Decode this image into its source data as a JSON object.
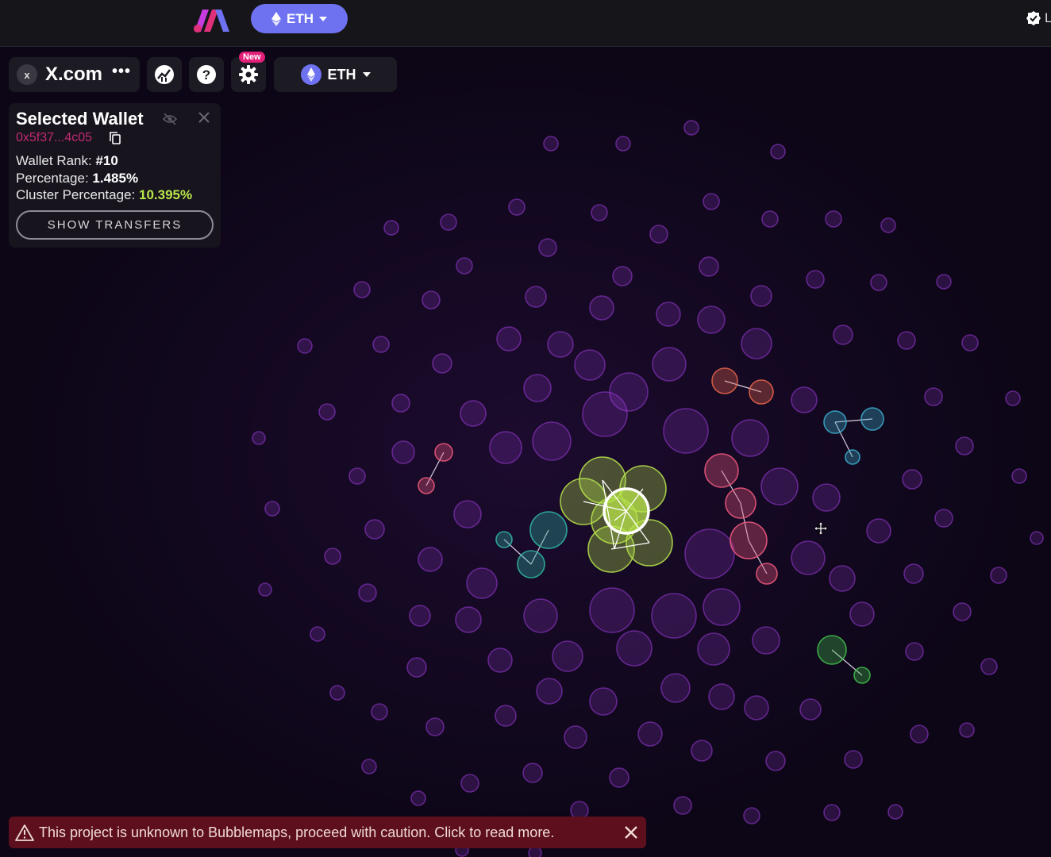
{
  "header": {
    "chain_label": "ETH",
    "user_initial": "L"
  },
  "toolbar": {
    "token_close": "x",
    "token_name": "X.com",
    "more_label": "•••",
    "new_badge": "New",
    "chain_label": "ETH"
  },
  "wallet_panel": {
    "title": "Selected Wallet",
    "address": "0x5f37...4c05",
    "rank_label": "Wallet Rank:",
    "rank_value": "#10",
    "percentage_label": "Percentage:",
    "percentage_value": "1.485%",
    "cluster_label": "Cluster Percentage:",
    "cluster_value": "10.395%",
    "show_transfers": "SHOW TRANSFERS"
  },
  "warning": {
    "text": "This project is unknown to Bubblemaps, proceed with caution. Click to read more."
  },
  "colors": {
    "background": "#0c0616",
    "purple_bubble": "#9a3ad8",
    "selected_cluster": "#b9e54c",
    "red_cluster": "#e8577a",
    "orange_cluster": "#e0604a",
    "teal_cluster": "#2fb0a0",
    "blue_cluster": "#3aa5c7",
    "green_cluster": "#3fb84a",
    "accent": "#6e72f0",
    "warning": "#5d0f1d"
  },
  "icons": {
    "logo": "bubblemaps-logo",
    "chain": "ethereum-icon",
    "chart": "chart-icon",
    "help": "question-icon",
    "settings": "gear-icon",
    "hide": "eye-off-icon",
    "close": "close-icon",
    "copy": "copy-icon",
    "warning": "warning-triangle-icon",
    "cursor": "move-cursor-icon"
  }
}
